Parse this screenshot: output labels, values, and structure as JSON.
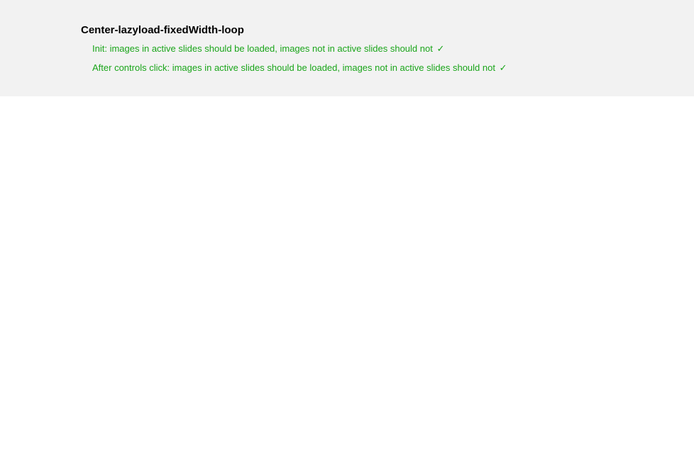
{
  "test": {
    "title": "Center-lazyload-fixedWidth-loop",
    "results": [
      {
        "text": "Init: images in active slides should be loaded, images not in active slides should not",
        "passed": true,
        "checkmark": "✓"
      },
      {
        "text": "After controls click: images in active slides should be loaded, images not in active slides should not",
        "passed": true,
        "checkmark": "✓"
      }
    ]
  }
}
